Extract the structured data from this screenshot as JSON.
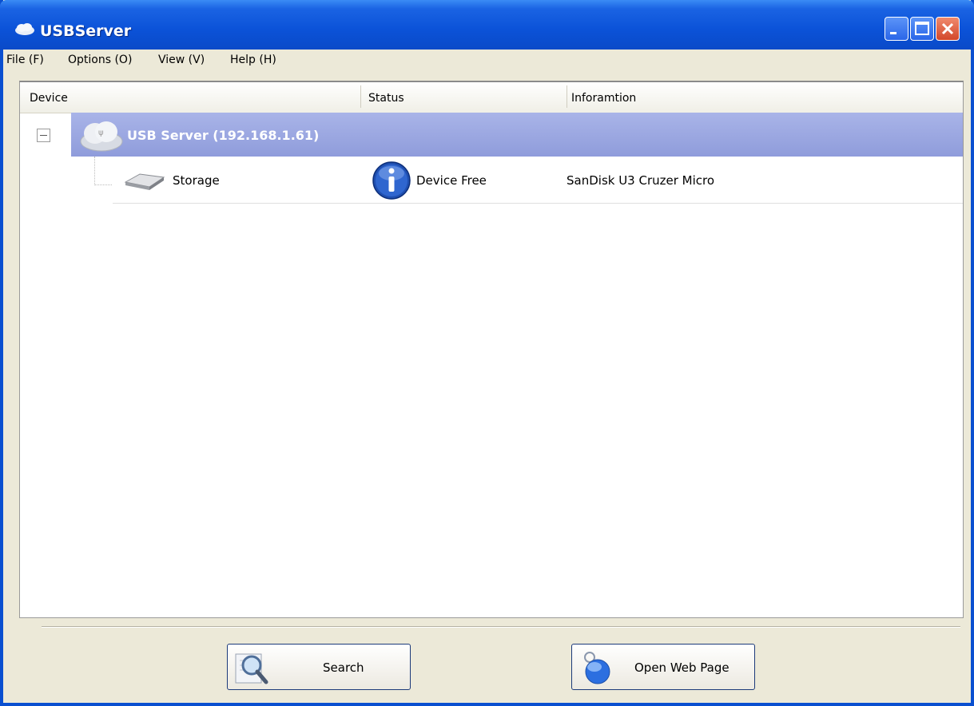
{
  "window": {
    "title": "USBServer"
  },
  "menu": [
    {
      "label": "File (F)"
    },
    {
      "label": "Options (O)"
    },
    {
      "label": "View (V)"
    },
    {
      "label": "Help (H)"
    }
  ],
  "columns": [
    "Device",
    "Status",
    "Inforamtion"
  ],
  "server": {
    "label": "USB Server  (192.168.1.61)"
  },
  "devices": [
    {
      "name": "Storage",
      "status": "Device Free",
      "info": "SanDisk U3 Cruzer Micro"
    }
  ],
  "buttons": {
    "search": "Search",
    "open_web": "Open Web Page"
  },
  "colors": {
    "titlebar": "#0a52d8",
    "selected_row": "#9ba6e0",
    "close_button": "#d2472a"
  }
}
